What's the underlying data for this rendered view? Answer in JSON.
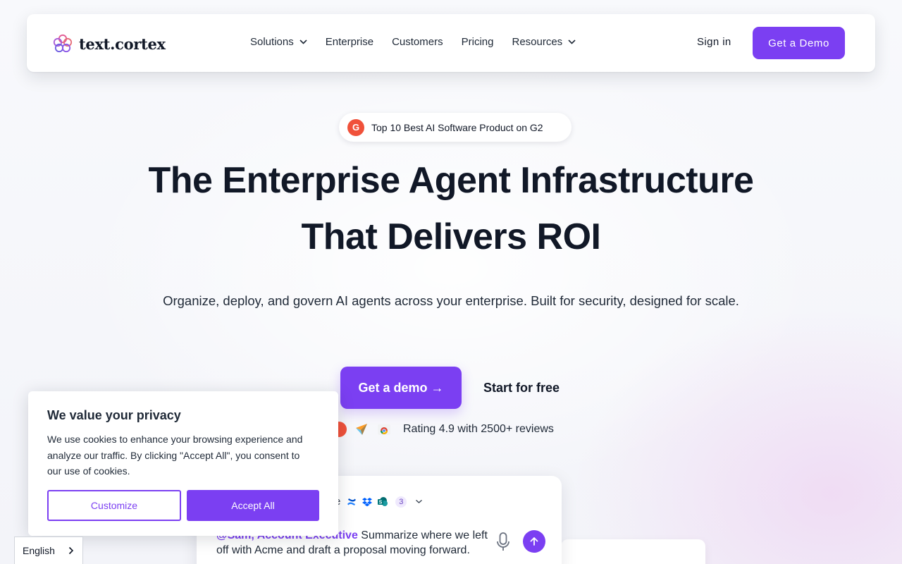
{
  "nav": {
    "logo_text": "text.cortex",
    "links": [
      {
        "label": "Solutions",
        "has_dropdown": true
      },
      {
        "label": "Enterprise",
        "has_dropdown": false
      },
      {
        "label": "Customers",
        "has_dropdown": false
      },
      {
        "label": "Pricing",
        "has_dropdown": false
      },
      {
        "label": "Resources",
        "has_dropdown": true
      }
    ],
    "signin_label": "Sign in",
    "demo_label": "Get a Demo"
  },
  "hero": {
    "badge_icon": "g2-logo",
    "badge_text": "Top 10 Best AI Software Product on G2",
    "title_line1": "The Enterprise Agent Infrastructure",
    "title_line2": "That Delivers ROI",
    "subtitle": "Organize, deploy, and govern AI agents across your enterprise. Built for security, designed for scale.",
    "cta_primary": "Get a demo →",
    "cta_secondary": "Start for free",
    "rating_icons": [
      "g2-icon",
      "capterra-icon",
      "chrome-store-icon"
    ],
    "rating_text": "Rating 4.9 with 2500+ reviews"
  },
  "prompt_card": {
    "tools_prefix": "e",
    "tool_icons": [
      "confluence-icon",
      "dropbox-icon",
      "sharepoint-icon"
    ],
    "tool_count": "3",
    "mention": "@Sam, Account Executive",
    "text": " Summarize where we left off with Acme and draft a proposal moving forward."
  },
  "cookie": {
    "title": "We value your privacy",
    "body": "We use cookies to enhance your browsing experience and analyze our traffic. By clicking \"Accept All\", you consent to our use of cookies.",
    "customize_label": "Customize",
    "accept_label": "Accept All"
  },
  "language": {
    "selected": "English"
  },
  "colors": {
    "accent": "#7b3ff2",
    "text": "#111827",
    "g2": "#f0513a"
  }
}
